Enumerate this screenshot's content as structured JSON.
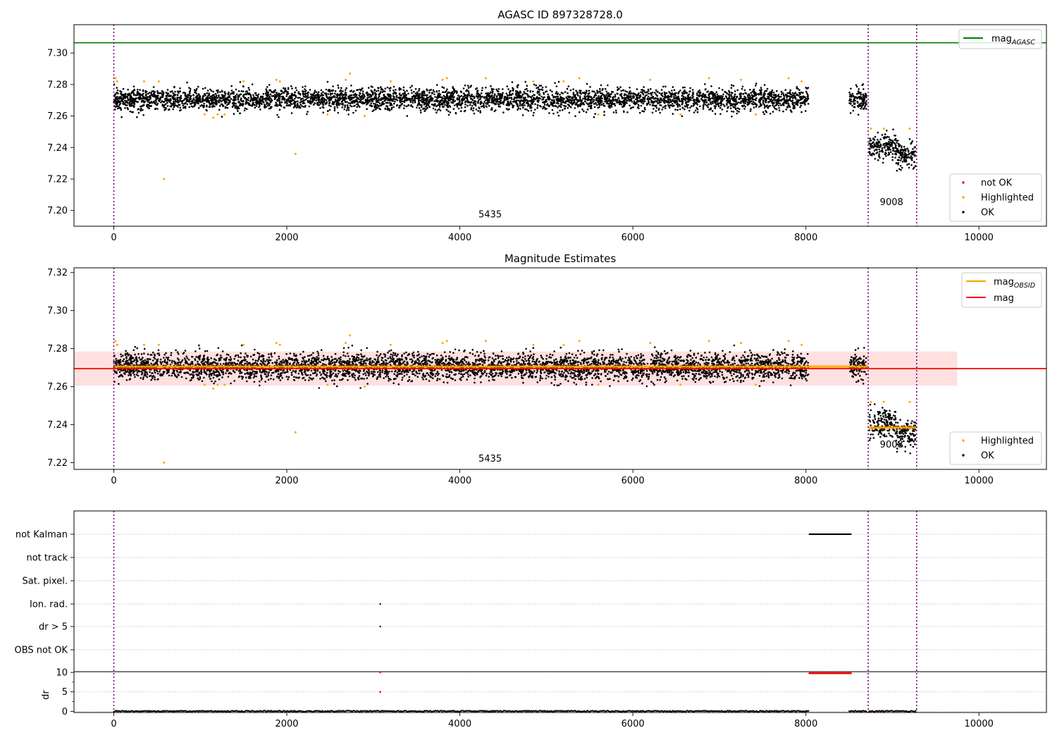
{
  "chart_data": [
    {
      "type": "scatter",
      "title": "AGASC ID 897328728.0",
      "xlim": [
        -460,
        10780
      ],
      "ylim": [
        7.19,
        7.318
      ],
      "xticks": [
        0,
        2000,
        4000,
        6000,
        8000,
        10000
      ],
      "xtick_labels": [
        "0",
        "2000",
        "4000",
        "6000",
        "8000",
        "10000"
      ],
      "yticks": [
        7.2,
        7.22,
        7.24,
        7.26,
        7.28,
        7.3
      ],
      "ytick_labels": [
        "7.20",
        "7.22",
        "7.24",
        "7.26",
        "7.28",
        "7.30"
      ],
      "obsid_boundaries": [
        0,
        8720,
        9280
      ],
      "obsid_labels": [
        {
          "text": "5435",
          "x": 4350,
          "y": 7.1955
        },
        {
          "text": "9008",
          "x": 8990,
          "y": 7.2035
        }
      ],
      "mag_agasc": 7.3065,
      "series": [
        {
          "name": "not OK",
          "color": "#ff0000",
          "points": []
        },
        {
          "name": "Highlighted",
          "color": "#ffa500",
          "points": [
            [
              20,
              7.284
            ],
            [
              40,
              7.282
            ],
            [
              350,
              7.282
            ],
            [
              520,
              7.282
            ],
            [
              580,
              7.22
            ],
            [
              1050,
              7.261
            ],
            [
              1150,
              7.259
            ],
            [
              1200,
              7.261
            ],
            [
              1280,
              7.261
            ],
            [
              1500,
              7.282
            ],
            [
              1880,
              7.283
            ],
            [
              1920,
              7.282
            ],
            [
              2100,
              7.236
            ],
            [
              2470,
              7.261
            ],
            [
              2680,
              7.283
            ],
            [
              2730,
              7.287
            ],
            [
              2900,
              7.26
            ],
            [
              3200,
              7.282
            ],
            [
              3800,
              7.283
            ],
            [
              3850,
              7.284
            ],
            [
              4300,
              7.284
            ],
            [
              4850,
              7.282
            ],
            [
              5200,
              7.282
            ],
            [
              5380,
              7.284
            ],
            [
              5600,
              7.261
            ],
            [
              6200,
              7.283
            ],
            [
              6550,
              7.261
            ],
            [
              6880,
              7.284
            ],
            [
              7250,
              7.283
            ],
            [
              7420,
              7.261
            ],
            [
              7800,
              7.284
            ],
            [
              7950,
              7.282
            ],
            [
              8750,
              7.252
            ],
            [
              8900,
              7.252
            ],
            [
              9200,
              7.252
            ]
          ]
        },
        {
          "name": "OK",
          "color": "#000000",
          "distribution": [
            {
              "x": [
                0,
                8030
              ],
              "mean": 7.2705,
              "spread": 0.0035
            },
            {
              "x": [
                8500,
                8700
              ],
              "mean": 7.2705,
              "spread": 0.0035
            },
            {
              "x": [
                8730,
                9040
              ],
              "mean": 7.2405,
              "spread": 0.004
            },
            {
              "x": [
                9040,
                9270
              ],
              "mean": 7.2355,
              "spread": 0.004
            }
          ]
        }
      ],
      "legend_lines": [
        {
          "name": "mag_AGASC",
          "color": "#008000"
        }
      ],
      "legend_points": [
        {
          "name": "not OK",
          "color": "#ff0000"
        },
        {
          "name": "Highlighted",
          "color": "#ffa500"
        },
        {
          "name": "OK",
          "color": "#000000"
        }
      ]
    },
    {
      "type": "scatter",
      "title": "Magnitude Estimates",
      "xlim": [
        -460,
        10780
      ],
      "ylim": [
        7.2165,
        7.3225
      ],
      "xticks": [
        0,
        2000,
        4000,
        6000,
        8000,
        10000
      ],
      "xtick_labels": [
        "0",
        "2000",
        "4000",
        "6000",
        "8000",
        "10000"
      ],
      "yticks": [
        7.22,
        7.24,
        7.26,
        7.28,
        7.3,
        7.32
      ],
      "ytick_labels": [
        "7.22",
        "7.24",
        "7.26",
        "7.28",
        "7.30",
        "7.32"
      ],
      "obsid_boundaries": [
        0,
        8720,
        9280
      ],
      "obsid_labels": [
        {
          "text": "5435",
          "x": 4350,
          "y": 7.2205
        },
        {
          "text": "9008",
          "x": 8990,
          "y": 7.228
        }
      ],
      "mag": 7.2695,
      "mag_band": [
        7.2605,
        7.2785
      ],
      "mag_band_x": [
        -460,
        9750
      ],
      "mag_obsid": [
        {
          "x": [
            0,
            8720
          ],
          "value": 7.2705
        },
        {
          "x": [
            8720,
            9280
          ],
          "value": 7.2385
        }
      ],
      "series": [
        {
          "name": "Highlighted",
          "color": "#ffa500",
          "points": [
            [
              20,
              7.284
            ],
            [
              40,
              7.282
            ],
            [
              350,
              7.282
            ],
            [
              520,
              7.282
            ],
            [
              580,
              7.22
            ],
            [
              1050,
              7.261
            ],
            [
              1150,
              7.259
            ],
            [
              1200,
              7.261
            ],
            [
              1280,
              7.261
            ],
            [
              1500,
              7.282
            ],
            [
              1880,
              7.283
            ],
            [
              1920,
              7.282
            ],
            [
              2100,
              7.236
            ],
            [
              2470,
              7.261
            ],
            [
              2680,
              7.283
            ],
            [
              2730,
              7.287
            ],
            [
              2900,
              7.26
            ],
            [
              3200,
              7.282
            ],
            [
              3800,
              7.283
            ],
            [
              3850,
              7.284
            ],
            [
              4300,
              7.284
            ],
            [
              4850,
              7.282
            ],
            [
              5200,
              7.282
            ],
            [
              5380,
              7.284
            ],
            [
              5600,
              7.261
            ],
            [
              6200,
              7.283
            ],
            [
              6550,
              7.261
            ],
            [
              6880,
              7.284
            ],
            [
              7250,
              7.283
            ],
            [
              7420,
              7.261
            ],
            [
              7800,
              7.284
            ],
            [
              7950,
              7.282
            ],
            [
              8750,
              7.252
            ],
            [
              8900,
              7.252
            ],
            [
              9200,
              7.252
            ]
          ]
        },
        {
          "name": "OK",
          "color": "#000000",
          "distribution": [
            {
              "x": [
                0,
                8030
              ],
              "mean": 7.2705,
              "spread": 0.0035
            },
            {
              "x": [
                8500,
                8700
              ],
              "mean": 7.2705,
              "spread": 0.0035
            },
            {
              "x": [
                8730,
                9040
              ],
              "mean": 7.2405,
              "spread": 0.004
            },
            {
              "x": [
                9040,
                9270
              ],
              "mean": 7.2355,
              "spread": 0.004
            }
          ]
        }
      ],
      "legend_lines": [
        {
          "name": "mag_OBSID",
          "color": "#ffa500"
        },
        {
          "name": "mag",
          "color": "#ff0000"
        }
      ],
      "legend_points": [
        {
          "name": "Highlighted",
          "color": "#ffa500"
        },
        {
          "name": "OK",
          "color": "#000000"
        }
      ]
    },
    {
      "type": "scatter",
      "title": "",
      "xlim": [
        -460,
        10780
      ],
      "xticks": [
        0,
        2000,
        4000,
        6000,
        8000,
        10000
      ],
      "xtick_labels": [
        "0",
        "2000",
        "4000",
        "6000",
        "8000",
        "10000"
      ],
      "obsid_boundaries": [
        0,
        8720,
        9280
      ],
      "flag_labels": [
        "not Kalman",
        "not track",
        "Sat. pixel.",
        "Ion. rad.",
        "dr > 5",
        "OBS not OK"
      ],
      "flags": [
        {
          "label": "not Kalman",
          "x": [
            8040,
            8520
          ]
        },
        {
          "label": "not track",
          "x": []
        },
        {
          "label": "Sat. pixel.",
          "x": []
        },
        {
          "label": "Ion. rad.",
          "x": [
            3080
          ]
        },
        {
          "label": "dr > 5",
          "x": [
            3080
          ]
        },
        {
          "label": "OBS not OK",
          "x": []
        }
      ],
      "dr": {
        "ylabel": "dr",
        "ylim": [
          -0.3,
          10.2
        ],
        "yticks": [
          0,
          5,
          10
        ],
        "ytick_labels": [
          "0",
          "5",
          "10"
        ],
        "baseline_segments": [
          [
            0,
            8030
          ],
          [
            8500,
            8700
          ],
          [
            8730,
            9270
          ]
        ],
        "high_segment": {
          "x": [
            8040,
            8520
          ],
          "value": 9.8
        },
        "isolated_points": [
          [
            3080,
            10.0
          ],
          [
            3080,
            5.0
          ]
        ]
      }
    }
  ]
}
